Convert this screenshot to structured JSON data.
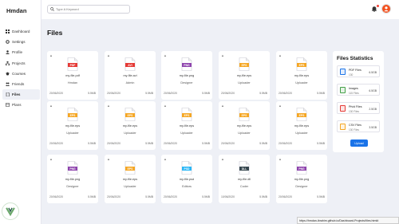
{
  "brand": "Hmdan",
  "sidebar": {
    "items": [
      {
        "label": "Dashboard",
        "icon": "dashboard-icon",
        "active": false
      },
      {
        "label": "Settings",
        "icon": "settings-icon",
        "active": false
      },
      {
        "label": "Profile",
        "icon": "user-icon",
        "active": false
      },
      {
        "label": "Projects",
        "icon": "diagram-icon",
        "active": false
      },
      {
        "label": "Courses",
        "icon": "graduation-icon",
        "active": false
      },
      {
        "label": "Friends",
        "icon": "friends-icon",
        "active": false
      },
      {
        "label": "Files",
        "icon": "files-icon",
        "active": true
      },
      {
        "label": "Plans",
        "icon": "plans-icon",
        "active": false
      }
    ]
  },
  "header": {
    "search_placeholder": "Type A Keyword"
  },
  "main": {
    "title": "Files"
  },
  "files": [
    {
      "type": "PDF",
      "color": "#e53935",
      "name": "my-file.pdf",
      "owner": "Hmdan",
      "date": "20/06/2020",
      "size": "5.5MB"
    },
    {
      "type": "AVI",
      "color": "#e53935",
      "name": "my-file.avi",
      "owner": "Admin",
      "date": "20/06/2020",
      "size": "5.5MB"
    },
    {
      "type": "PNG",
      "color": "#8e44ad",
      "name": "my-file.png",
      "owner": "Designer",
      "date": "20/06/2020",
      "size": "5.5MB"
    },
    {
      "type": "EPS",
      "color": "#f5a623",
      "name": "my-file.eps",
      "owner": "Uploader",
      "date": "20/06/2020",
      "size": "5.5MB"
    },
    {
      "type": "EPS",
      "color": "#f5a623",
      "name": "my-file.eps",
      "owner": "Uploader",
      "date": "20/06/2020",
      "size": "5.5MB"
    },
    {
      "type": "EPS",
      "color": "#f5a623",
      "name": "my-file.eps",
      "owner": "Uploader",
      "date": "20/06/2020",
      "size": "5.5MB"
    },
    {
      "type": "EPS",
      "color": "#f5a623",
      "name": "my-file.eps",
      "owner": "Uploader",
      "date": "20/06/2020",
      "size": "5.5MB"
    },
    {
      "type": "EPS",
      "color": "#f5a623",
      "name": "my-file.eps",
      "owner": "Uploader",
      "date": "20/06/2020",
      "size": "5.5MB"
    },
    {
      "type": "EPS",
      "color": "#f5a623",
      "name": "my-file.eps",
      "owner": "Uploader",
      "date": "20/06/2020",
      "size": "5.5MB"
    },
    {
      "type": "EPS",
      "color": "#f5a623",
      "name": "my-file.eps",
      "owner": "Uploader",
      "date": "20/06/2020",
      "size": "5.5MB"
    },
    {
      "type": "PNG",
      "color": "#8e44ad",
      "name": "my-file.png",
      "owner": "Designer",
      "date": "20/06/2020",
      "size": "5.5MB"
    },
    {
      "type": "EPS",
      "color": "#f5a623",
      "name": "my-file.eps",
      "owner": "Uploader",
      "date": "20/06/2020",
      "size": "5.5MB"
    },
    {
      "type": "PSD",
      "color": "#29b6f6",
      "name": "my-file.psd",
      "owner": "Editors",
      "date": "20/06/2020",
      "size": "5.5MB"
    },
    {
      "type": "DLL",
      "color": "#37474f",
      "name": "my-file.dll",
      "owner": "Coder",
      "date": "10/06/2020",
      "size": "5.5MB"
    },
    {
      "type": "PNG",
      "color": "#8e44ad",
      "name": "my-file.png",
      "owner": "Designer",
      "date": "20/06/2020",
      "size": "5.5MB"
    }
  ],
  "stats": {
    "title": "Files Statistics",
    "items": [
      {
        "name": "PDF Files",
        "count": "130",
        "size": "6.5GB",
        "color": "#1a73e8",
        "icon": "pdf-file-icon"
      },
      {
        "name": "Images",
        "count": "115 Files",
        "size": "6.5GB",
        "color": "#43a047",
        "icon": "image-icon"
      },
      {
        "name": "Pfvid Files",
        "count": "130 Files",
        "size": "2.5GB",
        "color": "#e53935",
        "icon": "video-file-icon"
      },
      {
        "name": "CSV Files",
        "count": "130 Files",
        "size": "3.5GB",
        "color": "#f5a623",
        "icon": "csv-file-icon"
      }
    ],
    "upload_label": "Upload"
  },
  "statusbar": "https://hmdan-ibrahim.github.io/Dashboard-Projects/files.html#"
}
